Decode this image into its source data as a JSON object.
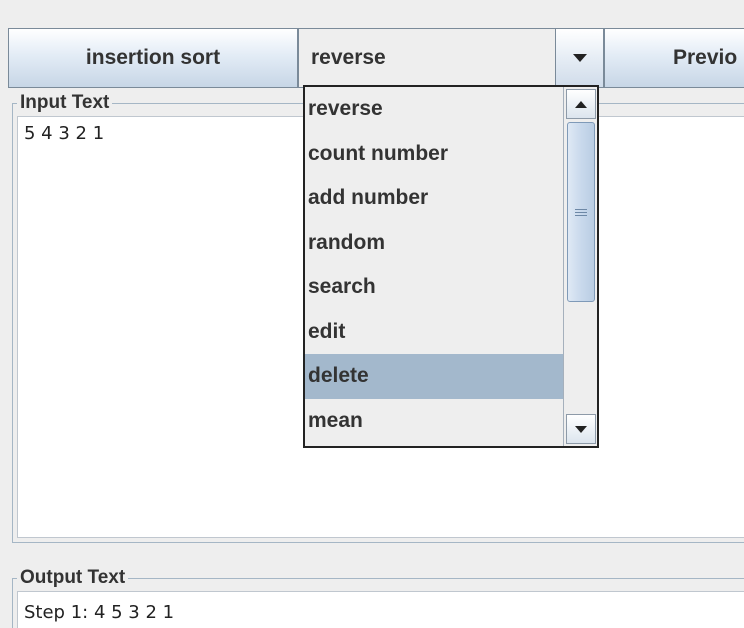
{
  "toolbar": {
    "sort_button_label": "insertion sort",
    "operation_combo_value": "reverse",
    "previous_button_label": "Previo"
  },
  "input_panel": {
    "title": "Input Text",
    "text": "5 4 3 2 1"
  },
  "output_panel": {
    "title": "Output Text",
    "text": "Step 1: 4 5 3 2 1"
  },
  "dropdown": {
    "items": [
      {
        "label": "reverse"
      },
      {
        "label": "count number"
      },
      {
        "label": "add number"
      },
      {
        "label": "random"
      },
      {
        "label": "search"
      },
      {
        "label": "edit"
      },
      {
        "label": "delete",
        "highlighted": true
      },
      {
        "label": "mean"
      }
    ]
  },
  "colors": {
    "highlight": "#a3b8cc",
    "panel_border": "#a5b6c5",
    "background": "#eeeeee"
  }
}
